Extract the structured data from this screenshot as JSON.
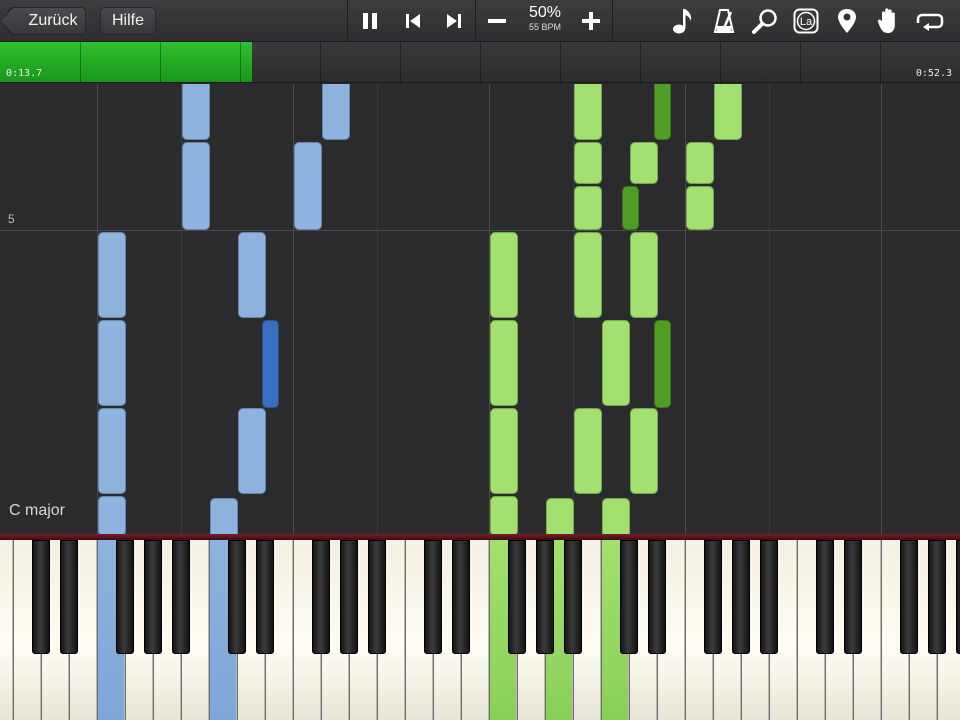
{
  "toolbar": {
    "back_label": "Zurück",
    "help_label": "Hilfe",
    "tempo_percent": "50%",
    "tempo_bpm": "55 BPM",
    "icons": [
      "pause-icon",
      "skip-back-icon",
      "skip-forward-icon",
      "minus-icon",
      "plus-icon",
      "note-icon",
      "metronome-icon",
      "magnifier-icon",
      "note-name-la-icon",
      "pin-icon",
      "hand-icon",
      "loop-icon"
    ],
    "note_name_label": "La"
  },
  "progress": {
    "current_time": "0:13.7",
    "total_time": "0:52.3",
    "fraction": 0.262,
    "color": "#22aa22"
  },
  "roll": {
    "measure_number": "5",
    "key_signature": "C major",
    "colors": {
      "left_hand": "#8fb3e0",
      "left_hand_dark": "#3a6fbf",
      "right_hand": "#a2e070",
      "right_hand_dark": "#4f9e23"
    }
  }
}
